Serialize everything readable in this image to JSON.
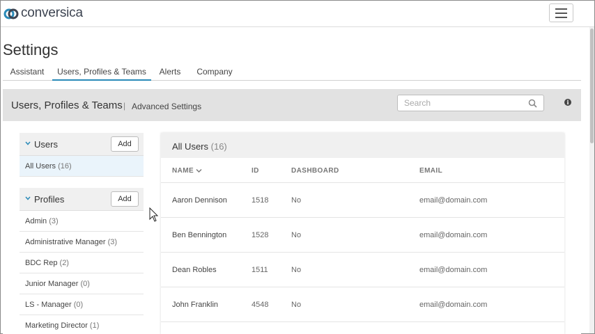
{
  "app": {
    "logo_text": "conversica",
    "brand_color": "#2a8ab8"
  },
  "page": {
    "title": "Settings"
  },
  "tabs": [
    {
      "label": "Assistant"
    },
    {
      "label": "Users, Profiles & Teams"
    },
    {
      "label": "Alerts"
    },
    {
      "label": "Company"
    }
  ],
  "panel": {
    "title": "Users, Profiles & Teams",
    "separator": "|",
    "advanced_label": "Advanced Settings",
    "search_placeholder": "Search"
  },
  "users_section": {
    "title": "Users",
    "add_label": "Add",
    "items": [
      {
        "label": "All Users",
        "count": "(16)"
      }
    ]
  },
  "profiles_section": {
    "title": "Profiles",
    "add_label": "Add",
    "items": [
      {
        "label": "Admin",
        "count": "(3)"
      },
      {
        "label": "Administrative Manager",
        "count": "(3)"
      },
      {
        "label": "BDC Rep",
        "count": "(2)"
      },
      {
        "label": "Junior Manager",
        "count": "(0)"
      },
      {
        "label": "LS - Manager",
        "count": "(0)"
      },
      {
        "label": "Marketing Director",
        "count": "(1)"
      }
    ]
  },
  "users_table": {
    "title": "All Users",
    "count": "(16)",
    "columns": [
      "NAME",
      "ID",
      "DASHBOARD",
      "EMAIL"
    ],
    "rows": [
      {
        "name": "Aaron Dennison",
        "id": "1518",
        "dashboard": "No",
        "email": "email@domain.com"
      },
      {
        "name": "Ben Bennington",
        "id": "1528",
        "dashboard": "No",
        "email": "email@domain.com"
      },
      {
        "name": "Dean Robles",
        "id": "1511",
        "dashboard": "No",
        "email": "email@domain.com"
      },
      {
        "name": "John Franklin",
        "id": "4548",
        "dashboard": "No",
        "email": "email@domain.com"
      }
    ]
  }
}
